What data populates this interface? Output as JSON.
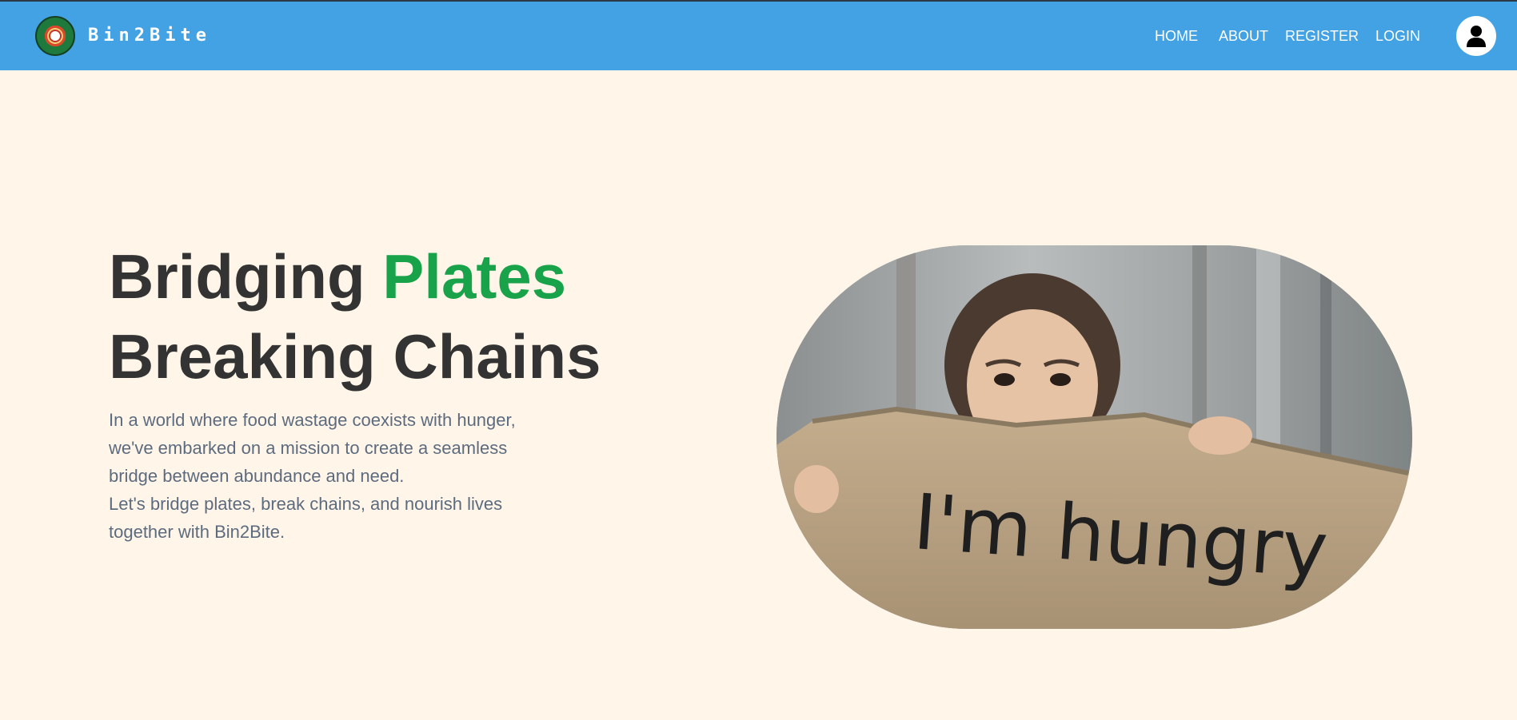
{
  "brand": {
    "name": "Bin2Bite",
    "logo_icon": "logo-icon"
  },
  "nav": {
    "items": [
      {
        "label": "HOME"
      },
      {
        "label": "ABOUT"
      },
      {
        "label": "REGISTER"
      },
      {
        "label": "LOGIN"
      }
    ],
    "profile_icon": "user-icon"
  },
  "hero": {
    "title_line1_part1": "Bridging ",
    "title_line1_accent": "Plates",
    "title_line2": "Breaking Chains",
    "description_line1": "In a world where food wastage coexists with hunger, we've embarked on a mission to create a seamless bridge between abundance and need.",
    "description_line2": "Let's bridge plates, break chains, and nourish lives together with Bin2Bite.",
    "image_sign_text": "I'm hungry"
  },
  "colors": {
    "navbar": "#42a2e4",
    "background": "#fff5e8",
    "accent": "#18a34a",
    "heading": "#333333",
    "body_text": "#5d6b7f"
  }
}
